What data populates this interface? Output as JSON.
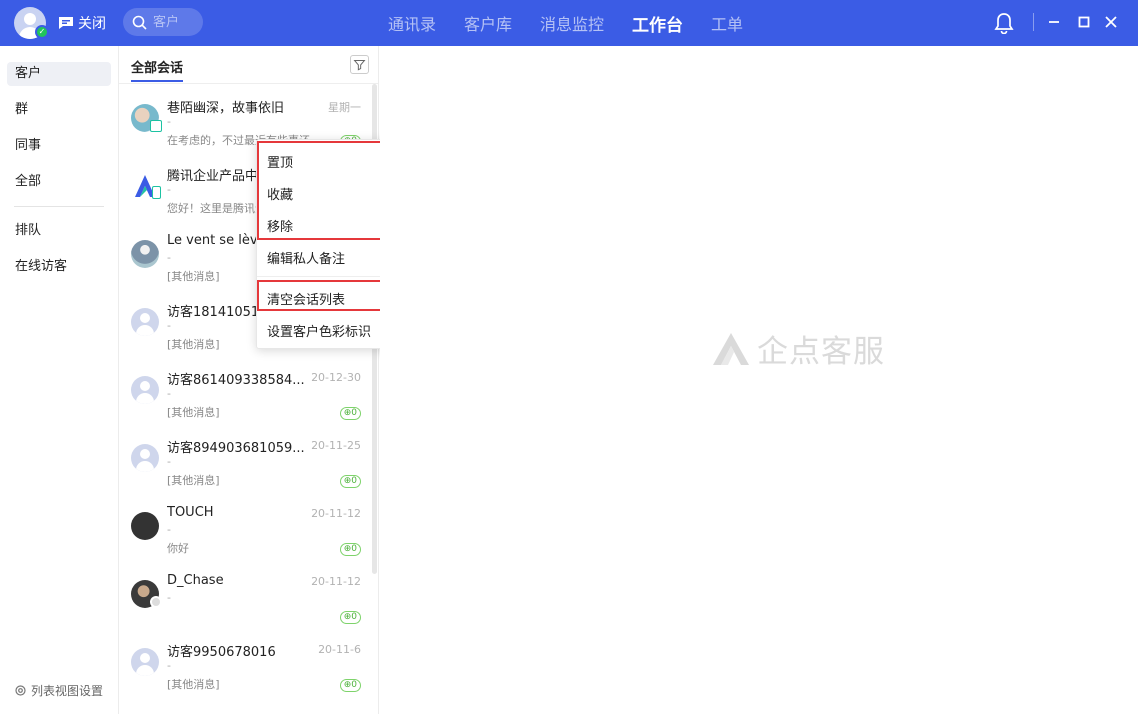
{
  "topbar": {
    "close_label": "关闭",
    "search_placeholder": "客户",
    "nav_tabs": [
      "通讯录",
      "客户库",
      "消息监控",
      "工作台",
      "工单"
    ],
    "active_tab": "工作台",
    "accent_color": "#3b5ce5"
  },
  "sidebar": {
    "items": [
      "客户",
      "群",
      "同事",
      "全部",
      "排队",
      "在线访客"
    ],
    "active_item": "客户",
    "settings_label": "列表视图设置"
  },
  "conversation_list": {
    "header": "全部会话",
    "rows": [
      {
        "name": "巷陌幽深，故事依旧",
        "time": "星期一",
        "sub": "-",
        "msg": "在考虑的，不过最近有些事还",
        "count": "0",
        "avatar": "photo1"
      },
      {
        "name": "腾讯企业产品中",
        "time": "",
        "sub": "-",
        "msg": "您好！这里是腾讯企",
        "count": "",
        "avatar": "logo"
      },
      {
        "name": "Le vent se lève",
        "time": "",
        "sub": "-",
        "msg": "[其他消息]",
        "count": "",
        "avatar": "photo2"
      },
      {
        "name": "访客181410511",
        "time": "",
        "sub": "-",
        "msg": "[其他消息]",
        "count": "",
        "avatar": "default"
      },
      {
        "name": "访客861409338584...",
        "time": "20-12-30",
        "sub": "-",
        "msg": "[其他消息]",
        "count": "0",
        "avatar": "default"
      },
      {
        "name": "访客894903681059...",
        "time": "20-11-25",
        "sub": "-",
        "msg": "[其他消息]",
        "count": "0",
        "avatar": "default"
      },
      {
        "name": "TOUCH",
        "time": "20-11-12",
        "sub": "-",
        "msg": "你好",
        "count": "0",
        "avatar": "touch"
      },
      {
        "name": "D_Chase",
        "time": "20-11-12",
        "sub": "-",
        "msg": "",
        "count": "0",
        "avatar": "chase"
      },
      {
        "name": "访客9950678016",
        "time": "20-11-6",
        "sub": "-",
        "msg": "[其他消息]",
        "count": "0",
        "avatar": "default"
      }
    ]
  },
  "context_menu": {
    "items": [
      "置顶",
      "收藏",
      "移除",
      "编辑私人备注",
      "清空会话列表",
      "设置客户色彩标识"
    ]
  },
  "main": {
    "watermark": "企点客服"
  }
}
